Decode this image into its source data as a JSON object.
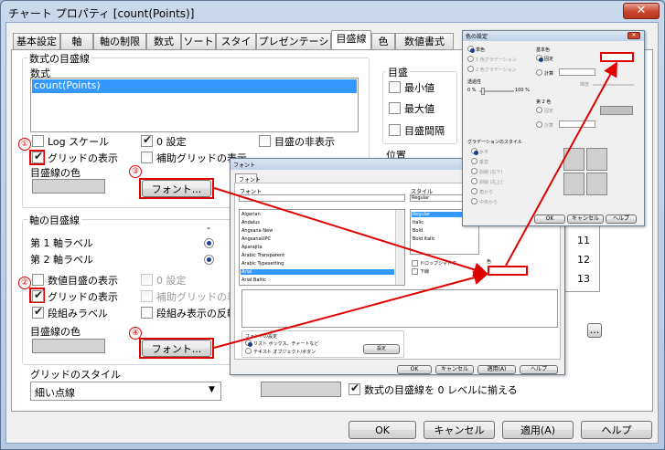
{
  "window": {
    "title": "チャート プロパティ [count(Points)]",
    "close": "✕"
  },
  "tabs": [
    "基本設定",
    "軸",
    "軸の制限",
    "数式",
    "ソート",
    "スタイル",
    "プレゼンテーション",
    "目盛線",
    "色",
    "数値書式",
    "フォント",
    "レイアウト",
    "キャプション"
  ],
  "expr_grid": {
    "group": "数式の目盛線",
    "expr_label": "数式",
    "expr_item": "count(Points)",
    "log": "Log スケール",
    "zero": "0 設定",
    "hide": "目盛の非表示",
    "show_grid": "グリッドの表示",
    "minor": "補助グリッドの表示",
    "color_label": "目盛線の色",
    "font_button": "フォント..."
  },
  "scale": {
    "group": "目盛",
    "min": "最小値",
    "max": "最大値",
    "interval": "目盛間隔"
  },
  "position_label": "位置",
  "axis_grid": {
    "group": "軸の目盛線",
    "dash": "-",
    "first": "第 1 軸ラベル",
    "second": "第 2 軸ラベル",
    "numeric": "数値目盛の表示",
    "zero": "0 設定",
    "show_grid": "グリッドの表示",
    "minor": "補助グリッドの表示",
    "stack": "段組みラベル",
    "stack_display": "段組み表示の反転",
    "color_label": "目盛線の色",
    "font_button": "フォント..."
  },
  "grid_style": {
    "label": "グリッドのスタイル",
    "value": "細い点線"
  },
  "align_zero": "数式の目盛線を 0 レベルに揃える",
  "markers": [
    "①",
    "②",
    "③",
    "④"
  ],
  "buttons": {
    "ok": "OK",
    "cancel": "キャンセル",
    "apply": "適用(A)",
    "help": "ヘルプ"
  },
  "side_list": [
    "11",
    "12",
    "13",
    "14"
  ],
  "ellipsis": "...",
  "font_dialog": {
    "title": "フォント",
    "tab": "フォント",
    "font_label": "フォント",
    "style_label": "スタイル",
    "fonts": [
      "Algerian",
      "Andalus",
      "Angsana New",
      "AngsanaUPC",
      "Aparajita",
      "Arabic Transparent",
      "Arabic Typesetting",
      "Arial",
      "Arial Baltic"
    ],
    "selected_font": "Arial",
    "styles": [
      "Regular",
      "Italic",
      "Bold",
      "Bold Italic"
    ],
    "selected_style": "Regular",
    "sizes": [
      "11",
      "12",
      "13",
      "14"
    ],
    "shadow": "ドロップシャドウ",
    "underline": "下線",
    "color_label": "色",
    "settings_label": "フォントの設定",
    "radio1": "リスト ボックス、チャートなど",
    "radio2": "テキスト オブジェクト/ボタン",
    "settings_button": "設定",
    "ok": "OK",
    "cancel": "キャンセル",
    "apply": "適用(A)",
    "help": "ヘルプ"
  },
  "color_dialog": {
    "title": "色の設定",
    "opt_single": "単色",
    "opt_grad1": "1 色グラデーション",
    "opt_grad2": "2 色グラデーション",
    "transparency": "透過性",
    "pct0": "0 %",
    "pct100": "100 %",
    "base_color": "基本色",
    "fixed": "固定",
    "calc": "計算",
    "bright": "輝度",
    "second_color": "第 2 色",
    "fixed2": "固定",
    "calc2": "計算",
    "grad_style": "グラデーションのスタイル",
    "horizontal": "水平",
    "vertical": "垂直",
    "diag_down": "斜線 (右下)",
    "diag_up": "斜線 (右上)",
    "from_corner": "角から",
    "from_center": "中央から",
    "ok": "OK",
    "cancel": "キャンセル",
    "help": "ヘルプ"
  }
}
